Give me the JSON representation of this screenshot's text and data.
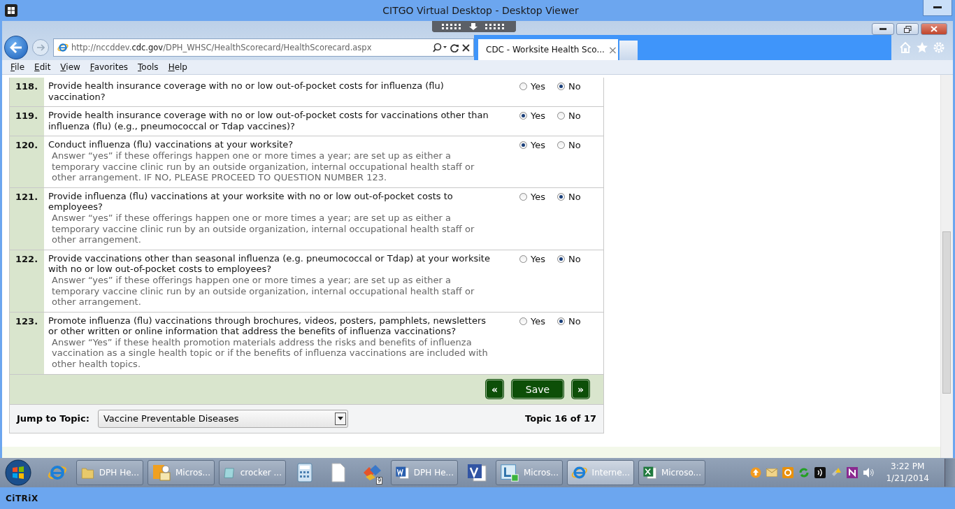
{
  "window": {
    "title": "CITGO Virtual Desktop - Desktop Viewer"
  },
  "browser": {
    "address": {
      "prefix": "http://nccddev.",
      "domain": "cdc.gov",
      "path": "/DPH_WHSC/HealthScorecard/HealthScorecard.aspx"
    },
    "tab": {
      "title": "CDC - Worksite Health Sco...",
      "close": "×"
    },
    "menu": [
      "File",
      "Edit",
      "View",
      "Favorites",
      "Tools",
      "Help"
    ]
  },
  "questions": [
    {
      "number": "118.",
      "text": "Provide health insurance coverage with no or low out-of-pocket costs for influenza (flu) vaccination?",
      "options": [
        {
          "label": "Yes",
          "selected": false
        },
        {
          "label": "No",
          "selected": true
        }
      ]
    },
    {
      "number": "119.",
      "text": "Provide health insurance coverage with no or low out-of-pocket costs for vaccinations other than influenza (flu) (e.g., pneumococcal or Tdap vaccines)?",
      "options": [
        {
          "label": "Yes",
          "selected": true
        },
        {
          "label": "No",
          "selected": false
        }
      ]
    },
    {
      "number": "120.",
      "text": "Conduct influenza (flu) vaccinations at your worksite?",
      "hint": "Answer “yes” if these offerings happen one or more times a year; are set up as either a temporary vaccine clinic run by an outside organization, internal occupational health staff or other arrangement. IF NO, PLEASE PROCEED TO QUESTION NUMBER 123.",
      "options": [
        {
          "label": "Yes",
          "selected": true
        },
        {
          "label": "No",
          "selected": false
        }
      ]
    },
    {
      "number": "121.",
      "text": "Provide influenza (flu) vaccinations at your worksite with no or low out-of-pocket costs to employees?",
      "hint": "Answer “yes” if these offerings happen one or more times a year; are set up as either a temporary vaccine clinic run by an outside organization, internal occupational health staff or other arrangement.",
      "options": [
        {
          "label": "Yes",
          "selected": false
        },
        {
          "label": "No",
          "selected": true
        }
      ]
    },
    {
      "number": "122.",
      "text": "Provide vaccinations other than seasonal influenza (e.g. pneumococcal or Tdap) at your worksite with no or low out-of-pocket costs to employees?",
      "hint": "Answer “yes” if these offerings happen one or more times a year; are set up as either a temporary vaccine clinic run by an outside organization, internal occupational health staff or other arrangement.",
      "options": [
        {
          "label": "Yes",
          "selected": false
        },
        {
          "label": "No",
          "selected": true
        }
      ]
    },
    {
      "number": "123.",
      "text": "Promote influenza (flu) vaccinations through brochures, videos, posters, pamphlets, newsletters or other written or online information that address the benefits of influenza vaccinations?",
      "hint": "Answer “Yes” if these health promotion materials address the risks and benefits of influenza vaccination as a single health topic or if the benefits of influenza vaccinations are included with other health topics.",
      "options": [
        {
          "label": "Yes",
          "selected": false
        },
        {
          "label": "No",
          "selected": true
        }
      ]
    }
  ],
  "nav_buttons": {
    "previous": "«",
    "save": "Save",
    "next": "»"
  },
  "jump": {
    "label": "Jump to Topic:",
    "value": "Vaccine Preventable Diseases",
    "position": "Topic 16 of 17"
  },
  "taskbar": {
    "items": [
      {
        "kind": "start"
      },
      {
        "kind": "pin"
      },
      {
        "kind": "window",
        "label": "DPH He...",
        "selected": false
      },
      {
        "kind": "window",
        "label": "Micros...",
        "selected": false
      },
      {
        "kind": "window",
        "label": "crocker ...",
        "selected": false
      },
      {
        "kind": "pin"
      },
      {
        "kind": "pin"
      },
      {
        "kind": "pin",
        "badge": "9"
      },
      {
        "kind": "window",
        "label": "DPH He...",
        "selected": false
      },
      {
        "kind": "pin"
      },
      {
        "kind": "window",
        "label": "Micros...",
        "selected": false
      },
      {
        "kind": "window",
        "label": "Interne...",
        "selected": true
      },
      {
        "kind": "window",
        "label": "Microso...",
        "selected": false
      }
    ],
    "clock": {
      "time": "3:22 PM",
      "date": "1/21/2014"
    }
  },
  "citrix": {
    "logo": "CiTRiX"
  }
}
